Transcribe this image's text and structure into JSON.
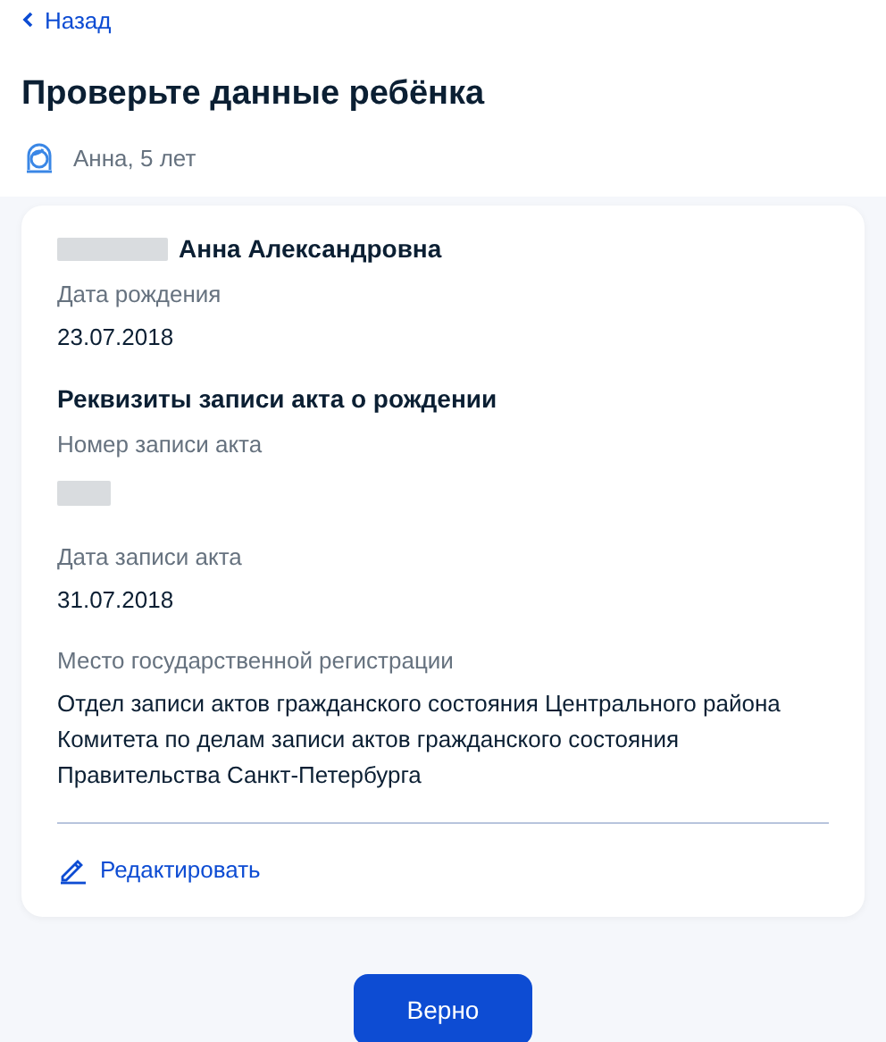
{
  "back_link": "Назад",
  "title": "Проверьте данные ребёнка",
  "child": "Анна, 5 лет",
  "card": {
    "items": [
      {
        "kind": "name",
        "text": "Анна Александровна",
        "redacted": true
      },
      {
        "kind": "field",
        "label": "Дата рождения",
        "value": "23.07.2018"
      },
      {
        "kind": "heading",
        "text": "Реквизиты записи акта о рождении"
      },
      {
        "kind": "field",
        "label": "Номер записи акта",
        "redacted": true
      },
      {
        "kind": "field",
        "label": "Дата записи акта",
        "value": "31.07.2018"
      },
      {
        "kind": "field",
        "label": "Место государственной регистрации",
        "value": "Отдел записи актов гражданского состояния Центрального района Комитета по делам записи актов гражданского состояния Правительства Санкт-Петербурга"
      }
    ],
    "edit_link": "Редактировать"
  },
  "confirm_button": "Верно"
}
